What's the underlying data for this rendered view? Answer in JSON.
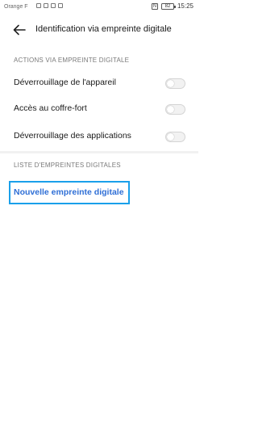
{
  "status_bar": {
    "carrier": "Orange F",
    "battery": "82",
    "time": "15:25"
  },
  "header": {
    "title": "Identification via empreinte digitale"
  },
  "sections": {
    "actions": {
      "title": "ACTIONS VIA EMPREINTE DIGITALE",
      "items": [
        {
          "label": "Déverrouillage de l'appareil",
          "enabled": false
        },
        {
          "label": "Accès au coffre-fort",
          "enabled": false
        },
        {
          "label": "Déverrouillage des applications",
          "enabled": false
        }
      ]
    },
    "fingerprints": {
      "title": "LISTE D'EMPREINTES DIGITALES",
      "new_label": "Nouvelle empreinte digitale"
    }
  },
  "colors": {
    "accent": "#2f6fd6",
    "highlight_border": "#1aa0ea"
  }
}
